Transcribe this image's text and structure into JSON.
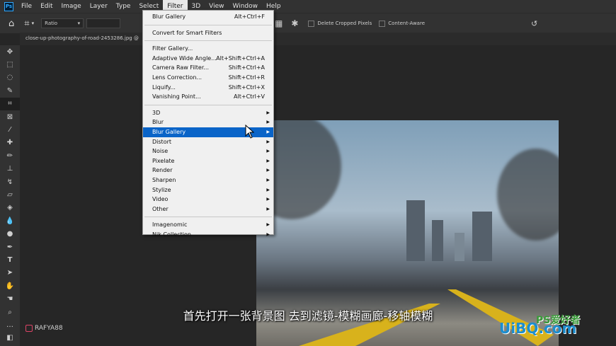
{
  "menubar": {
    "logo": "Ps",
    "items": [
      "File",
      "Edit",
      "Image",
      "Layer",
      "Type",
      "Select",
      "Filter",
      "3D",
      "View",
      "Window",
      "Help"
    ],
    "active": "Filter"
  },
  "options": {
    "ratio": "Ratio",
    "delete_cropped": "Delete Cropped Pixels",
    "content_aware": "Content-Aware"
  },
  "document": {
    "tab_title": "close-up-photography-of-road-2453286.jpg @"
  },
  "filter_menu": {
    "group1": [
      {
        "label": "Blur Gallery",
        "shortcut": "Alt+Ctrl+F"
      }
    ],
    "group2": [
      {
        "label": "Convert for Smart Filters"
      }
    ],
    "group3": [
      {
        "label": "Filter Gallery..."
      },
      {
        "label": "Adaptive Wide Angle...",
        "shortcut": "Alt+Shift+Ctrl+A"
      },
      {
        "label": "Camera Raw Filter...",
        "shortcut": "Shift+Ctrl+A"
      },
      {
        "label": "Lens Correction...",
        "shortcut": "Shift+Ctrl+R"
      },
      {
        "label": "Liquify...",
        "shortcut": "Shift+Ctrl+X"
      },
      {
        "label": "Vanishing Point...",
        "shortcut": "Alt+Ctrl+V"
      }
    ],
    "group4": [
      "3D",
      "Blur",
      "Blur Gallery",
      "Distort",
      "Noise",
      "Pixelate",
      "Render",
      "Sharpen",
      "Stylize",
      "Video",
      "Other"
    ],
    "group5": [
      "Imagenomic",
      "Nik Collection"
    ],
    "highlighted": "Blur Gallery"
  },
  "subtitle": "首先打开一张背景图 去到滤镜-模糊画廊-移轴模糊",
  "watermark": "RAFYA88",
  "site_logo": {
    "text": "UiBQ.com",
    "ps_text": "PS爱好者"
  },
  "colors": {
    "menu_highlight": "#0a64c8",
    "ui_bg": "#323232",
    "canvas_bg": "#262626",
    "road_line": "#d8b21c"
  }
}
